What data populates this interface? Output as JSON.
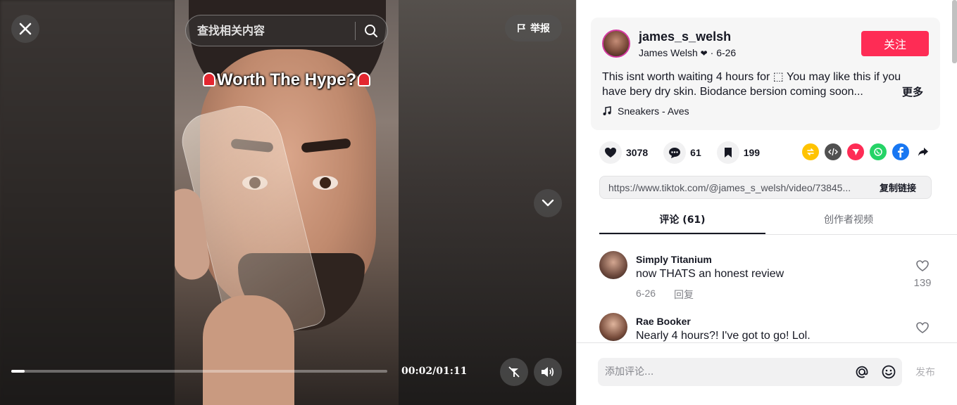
{
  "video": {
    "close_icon": "close-icon",
    "search": {
      "placeholder": "查找相关内容",
      "icon": "search-icon"
    },
    "report_label": "举报",
    "overlay_text": "Worth The Hype?",
    "progress_fraction": 0.035,
    "time": "00:02/01:11",
    "controls": [
      "floating-player-icon",
      "volume-icon"
    ]
  },
  "post": {
    "username": "james_s_welsh",
    "display_name": "James Welsh",
    "date": "6-26",
    "follow_label": "关注",
    "description": "This isnt worth waiting 4 hours for ⬚ You may like this if you have bery dry skin. Biodance bersion coming soon...",
    "more_label": "更多",
    "music": "Sneakers - Aves",
    "likes": "3078",
    "comments": "61",
    "saves": "199",
    "share_colors": {
      "repost": "#ffc300",
      "embed": "#505050",
      "send": "#fe2c55",
      "whatsapp": "#25d366",
      "facebook": "#1877f2"
    },
    "link": "https://www.tiktok.com/@james_s_welsh/video/73845...",
    "copy_label": "复制链接"
  },
  "tabs": {
    "comments": "评论 (61)",
    "creator_videos": "创作者视频"
  },
  "comment_list": [
    {
      "user": "Simply Titanium",
      "text": "now THATS an honest review",
      "date": "6-26",
      "reply": "回复",
      "likes": "139"
    },
    {
      "user": "Rae Booker",
      "text": "Nearly 4 hours?! I've got to go! Lol."
    }
  ],
  "compose": {
    "placeholder": "添加评论...",
    "post_label": "发布"
  },
  "colors": {
    "accent": "#fe2c55",
    "text": "#161823"
  }
}
